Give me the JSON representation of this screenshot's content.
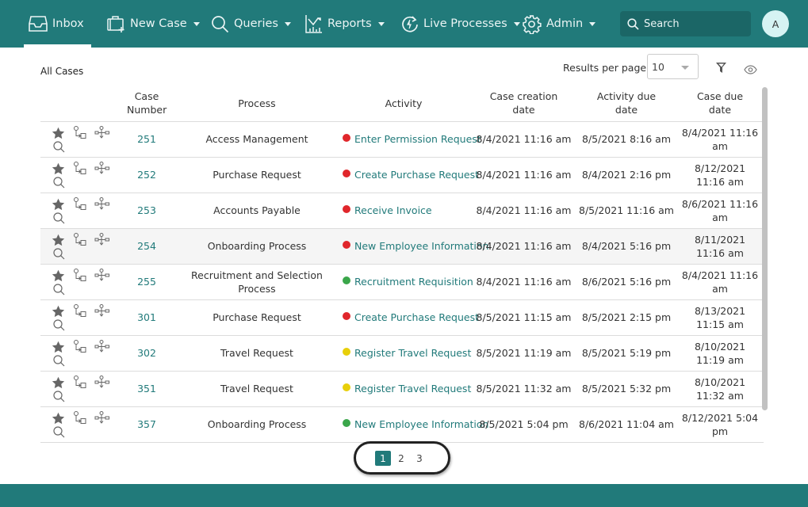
{
  "nav": {
    "items": [
      {
        "label": "Inbox",
        "icon": "inbox-icon",
        "active": true,
        "dropdown": false
      },
      {
        "label": "New Case",
        "icon": "new-case-icon",
        "dropdown": true
      },
      {
        "label": "Queries",
        "icon": "search-icon",
        "dropdown": true
      },
      {
        "label": "Reports",
        "icon": "reports-chart-icon",
        "dropdown": true
      },
      {
        "label": "Live Processes",
        "icon": "live-processes-icon",
        "dropdown": true
      },
      {
        "label": "Admin",
        "icon": "gear-icon",
        "dropdown": true
      }
    ],
    "search_placeholder": "Search",
    "avatar_initial": "A"
  },
  "toolbar": {
    "title": "All Cases",
    "results_per_page_label": "Results per page",
    "results_per_page_value": "10"
  },
  "table": {
    "columns": [
      "",
      "Case Number",
      "Process",
      "Activity",
      "Case creation date",
      "Activity due date",
      "Case due date"
    ],
    "rows": [
      {
        "case": "251",
        "process": "Access Management",
        "activity": "Enter Permission Request",
        "status": "red",
        "created": "8/4/2021 11:16 am",
        "activity_due": "8/5/2021 8:16 am",
        "case_due": "8/4/2021 11:16 am"
      },
      {
        "case": "252",
        "process": "Purchase Request",
        "activity": "Create Purchase Request",
        "status": "red",
        "created": "8/4/2021 11:16 am",
        "activity_due": "8/4/2021 2:16 pm",
        "case_due": "8/12/2021 11:16 am"
      },
      {
        "case": "253",
        "process": "Accounts Payable",
        "activity": "Receive Invoice",
        "status": "red",
        "created": "8/4/2021 11:16 am",
        "activity_due": "8/5/2021 11:16 am",
        "case_due": "8/6/2021 11:16 am"
      },
      {
        "case": "254",
        "process": "Onboarding Process",
        "activity": "New Employee Information",
        "status": "red",
        "created": "8/4/2021 11:16 am",
        "activity_due": "8/4/2021 5:16 pm",
        "case_due": "8/11/2021 11:16 am",
        "hovered": true
      },
      {
        "case": "255",
        "process": "Recruitment and Selection Process",
        "activity": "Recruitment Requisition",
        "status": "green",
        "created": "8/4/2021 11:16 am",
        "activity_due": "8/6/2021 5:16 pm",
        "case_due": "8/4/2021 11:16 am"
      },
      {
        "case": "301",
        "process": "Purchase Request",
        "activity": "Create Purchase Request",
        "status": "red",
        "created": "8/5/2021 11:15 am",
        "activity_due": "8/5/2021 2:15 pm",
        "case_due": "8/13/2021 11:15 am"
      },
      {
        "case": "302",
        "process": "Travel Request",
        "activity": "Register Travel Request",
        "status": "yellow",
        "created": "8/5/2021 11:19 am",
        "activity_due": "8/5/2021 5:19 pm",
        "case_due": "8/10/2021 11:19 am"
      },
      {
        "case": "351",
        "process": "Travel Request",
        "activity": "Register Travel Request",
        "status": "yellow",
        "created": "8/5/2021 11:32 am",
        "activity_due": "8/5/2021 5:32 pm",
        "case_due": "8/10/2021 11:32 am"
      },
      {
        "case": "357",
        "process": "Onboarding Process",
        "activity": "New Employee Information",
        "status": "green",
        "created": "8/5/2021 5:04 pm",
        "activity_due": "8/6/2021 11:04 am",
        "case_due": "8/12/2021 5:04 pm"
      }
    ]
  },
  "status_colors": {
    "red": "#e0262b",
    "green": "#3aa64a",
    "yellow": "#e8cf0a"
  },
  "colors": {
    "brand": "#217a7a",
    "link": "#217a7a"
  },
  "pagination": {
    "pages": [
      "1",
      "2",
      "3"
    ],
    "current": "1"
  }
}
